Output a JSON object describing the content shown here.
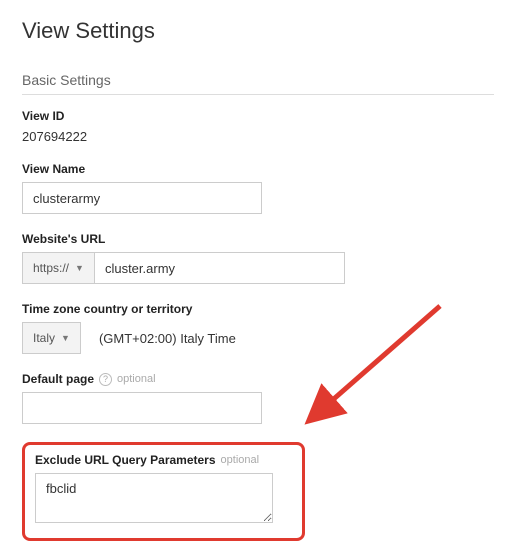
{
  "page_title": "View Settings",
  "section_title": "Basic Settings",
  "view_id": {
    "label": "View ID",
    "value": "207694222"
  },
  "view_name": {
    "label": "View Name",
    "value": "clusterarmy"
  },
  "website_url": {
    "label": "Website's URL",
    "protocol": "https://",
    "value": "cluster.army"
  },
  "timezone": {
    "label": "Time zone country or territory",
    "country": "Italy",
    "display": "(GMT+02:00) Italy Time"
  },
  "default_page": {
    "label": "Default page",
    "optional_label": "optional",
    "value": ""
  },
  "exclude_query": {
    "label": "Exclude URL Query Parameters",
    "optional_label": "optional",
    "value": "fbclid"
  },
  "colors": {
    "highlight": "#e03a2f"
  }
}
